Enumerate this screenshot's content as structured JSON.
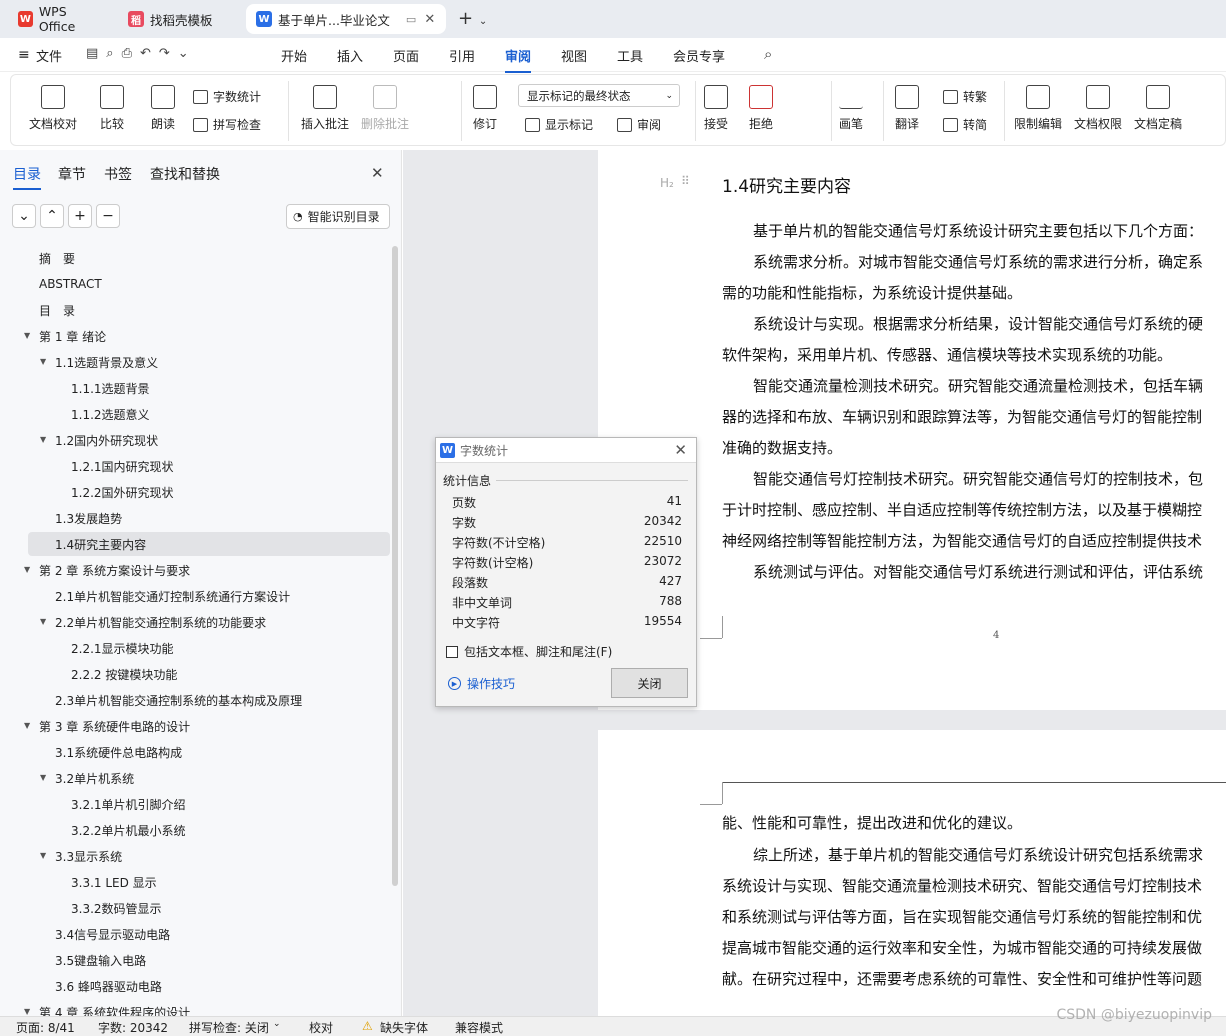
{
  "tabs": [
    {
      "label": "WPS Office"
    },
    {
      "label": "找稻壳模板"
    },
    {
      "label": "基于单片...毕业论文"
    }
  ],
  "menu": [
    "文件",
    "开始",
    "插入",
    "页面",
    "引用",
    "审阅",
    "视图",
    "工具",
    "会员专享"
  ],
  "ribbon": {
    "doc_check": "文档校对",
    "compare": "比较",
    "read_aloud": "朗读",
    "word_count": "字数统计",
    "spell_check": "拼写检查",
    "insert_comment": "插入批注",
    "delete_comment": "删除批注",
    "track": "修订",
    "markup_select": "显示标记的最终状态",
    "show_markup": "显示标记",
    "review": "审阅",
    "accept": "接受",
    "reject": "拒绝",
    "pen": "画笔",
    "translate": "翻译",
    "to_traditional": "转繁",
    "to_simplified": "转简",
    "restrict_edit": "限制编辑",
    "doc_perm": "文档权限",
    "finalize": "文档定稿"
  },
  "nav": {
    "tabs": [
      "目录",
      "章节",
      "书签",
      "查找和替换"
    ],
    "smart_toc": "智能识别目录",
    "items": [
      {
        "label": "摘　要"
      },
      {
        "label": "ABSTRACT"
      },
      {
        "label": "目　录"
      },
      {
        "label": "第 1 章  绪论"
      },
      {
        "label": "1.1选题背景及意义"
      },
      {
        "label": "1.1.1选题背景"
      },
      {
        "label": "1.1.2选题意义"
      },
      {
        "label": "1.2国内外研究现状"
      },
      {
        "label": "1.2.1国内研究现状"
      },
      {
        "label": "1.2.2国外研究现状"
      },
      {
        "label": "1.3发展趋势"
      },
      {
        "label": "1.4研究主要内容"
      },
      {
        "label": "第 2 章  系统方案设计与要求"
      },
      {
        "label": "2.1单片机智能交通灯控制系统通行方案设计"
      },
      {
        "label": "2.2单片机智能交通控制系统的功能要求"
      },
      {
        "label": "2.2.1显示模块功能"
      },
      {
        "label": "2.2.2  按键模块功能"
      },
      {
        "label": "2.3单片机智能交通控制系统的基本构成及原理"
      },
      {
        "label": "第 3 章  系统硬件电路的设计"
      },
      {
        "label": "3.1系统硬件总电路构成"
      },
      {
        "label": "3.2单片机系统"
      },
      {
        "label": "3.2.1单片机引脚介绍"
      },
      {
        "label": "3.2.2单片机最小系统"
      },
      {
        "label": "3.3显示系统"
      },
      {
        "label": "3.3.1 LED 显示"
      },
      {
        "label": "3.3.2数码管显示"
      },
      {
        "label": "3.4信号显示驱动电路"
      },
      {
        "label": "3.5键盘输入电路"
      },
      {
        "label": "3.6  蜂鸣器驱动电路"
      },
      {
        "label": "第 4 章  系统软件程序的设计"
      }
    ]
  },
  "doc": {
    "heading_marker": "H₂",
    "heading": "1.4研究主要内容",
    "lines": [
      "基于单片机的智能交通信号灯系统设计研究主要包括以下几个方面：",
      "系统需求分析。对城市智能交通信号灯系统的需求进行分析，确定系",
      "需的功能和性能指标，为系统设计提供基础。",
      "系统设计与实现。根据需求分析结果，设计智能交通信号灯系统的硬",
      "软件架构，采用单片机、传感器、通信模块等技术实现系统的功能。",
      "智能交通流量检测技术研究。研究智能交通流量检测技术，包括车辆",
      "器的选择和布放、车辆识别和跟踪算法等，为智能交通信号灯的智能控制",
      "准确的数据支持。",
      "智能交通信号灯控制技术研究。研究智能交通信号灯的控制技术，包",
      "于计时控制、感应控制、半自适应控制等传统控制方法，以及基于模糊控",
      "神经网络控制等智能控制方法，为智能交通信号灯的自适应控制提供技术",
      "系统测试与评估。对智能交通信号灯系统进行测试和评估，评估系统"
    ],
    "page_number": "4",
    "lines2": [
      "能、性能和可靠性，提出改进和优化的建议。",
      "综上所述，基于单片机的智能交通信号灯系统设计研究包括系统需求",
      "系统设计与实现、智能交通流量检测技术研究、智能交通信号灯控制技术",
      "和系统测试与评估等方面，旨在实现智能交通信号灯系统的智能控制和优",
      "提高城市智能交通的运行效率和安全性，为城市智能交通的可持续发展做",
      "献。在研究过程中，还需要考虑系统的可靠性、安全性和可维护性等问题"
    ]
  },
  "dialog": {
    "title": "字数统计",
    "section": "统计信息",
    "rows": [
      {
        "label": "页数",
        "value": "41"
      },
      {
        "label": "字数",
        "value": "20342"
      },
      {
        "label": "字符数(不计空格)",
        "value": "22510"
      },
      {
        "label": "字符数(计空格)",
        "value": "23072"
      },
      {
        "label": "段落数",
        "value": "427"
      },
      {
        "label": "非中文单词",
        "value": "788"
      },
      {
        "label": "中文字符",
        "value": "19554"
      }
    ],
    "checkbox": "包括文本框、脚注和尾注(F)",
    "tips": "操作技巧",
    "close": "关闭"
  },
  "status": {
    "page": "页面: 8/41",
    "words": "字数: 20342",
    "spell": "拼写检查: 关闭",
    "proof": "校对",
    "missing_font": "缺失字体",
    "compat": "兼容模式"
  },
  "watermark": "CSDN @biyezuopinvip"
}
